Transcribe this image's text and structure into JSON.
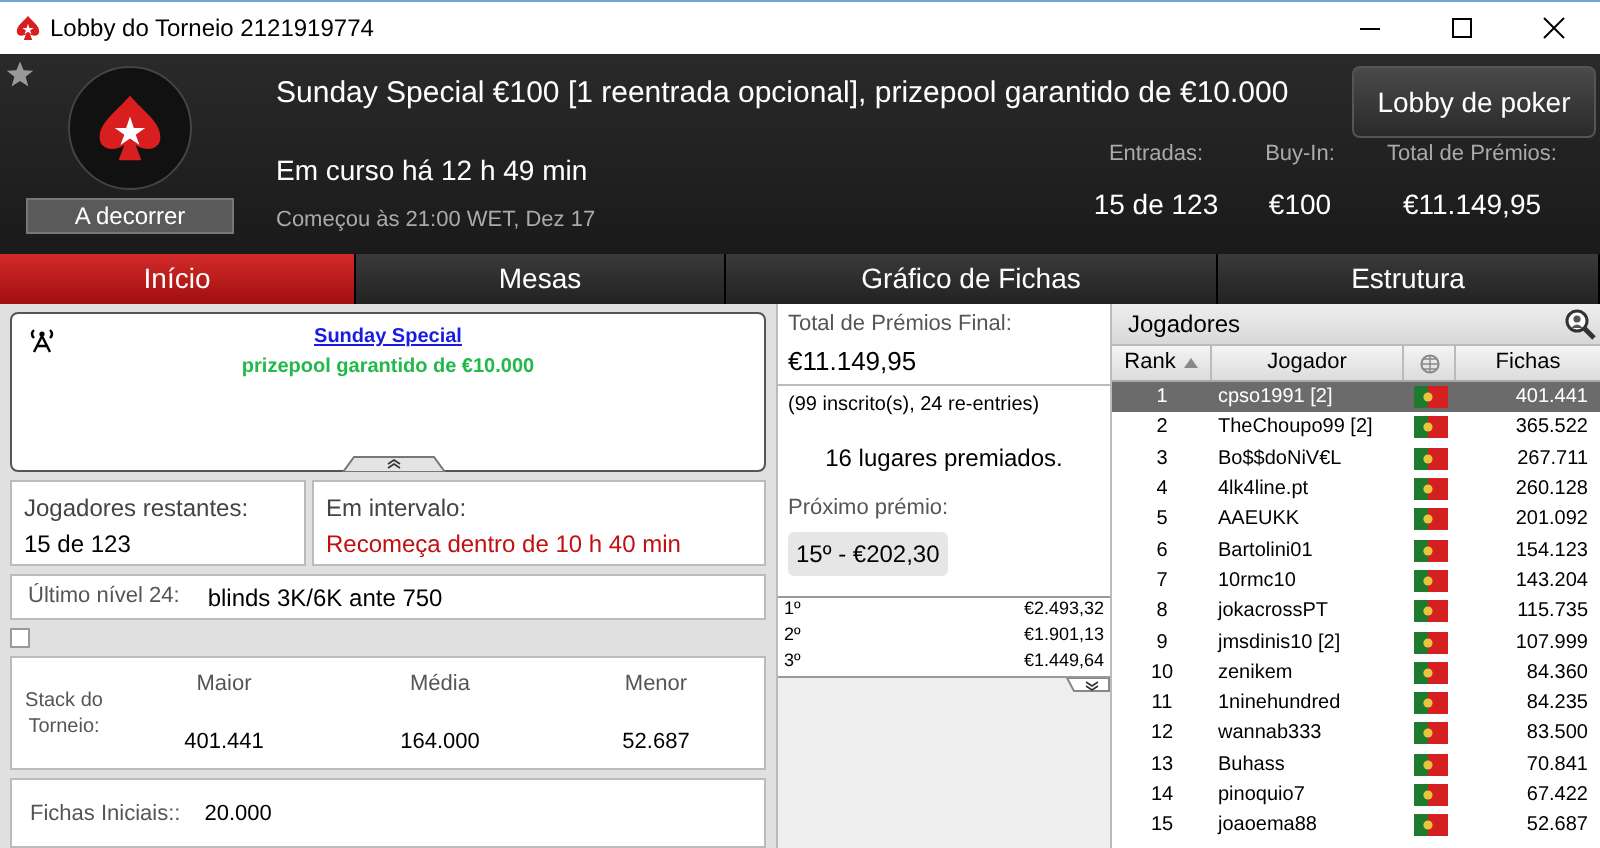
{
  "window": {
    "title": "Lobby do Torneio 2121919774"
  },
  "header": {
    "title": "Sunday Special €100 [1 reentrada opcional], prizepool garantido de €10.000",
    "status": "A decorrer",
    "running": "Em curso há 12 h 49 min",
    "started": "Começou às 21:00 WET, Dez 17",
    "lobby_button": "Lobby de poker",
    "stats": [
      {
        "label": "Entradas:",
        "value": "15 de 123"
      },
      {
        "label": "Buy-In:",
        "value": "€100"
      },
      {
        "label": "Total de Prémios:",
        "value": "€11.149,95"
      }
    ]
  },
  "tabs": [
    {
      "label": "Início",
      "selected": true
    },
    {
      "label": "Mesas",
      "selected": false
    },
    {
      "label": "Gráfico de Fichas",
      "selected": false
    },
    {
      "label": "Estrutura",
      "selected": false
    }
  ],
  "news": {
    "link": "Sunday Special",
    "subtitle": "prizepool garantido de €10.000"
  },
  "remaining": {
    "label": "Jogadores restantes:",
    "value": "15 de 123"
  },
  "break": {
    "label": "Em intervalo:",
    "value": "Recomeça dentro de 10 h 40 min"
  },
  "last_level": {
    "label": "Último nível 24:",
    "value": "blinds 3K/6K ante 750"
  },
  "checkbox": {
    "checked": false
  },
  "stack": {
    "label": "Stack do Torneio:",
    "columns": [
      {
        "label": "Maior",
        "value": "401.441"
      },
      {
        "label": "Média",
        "value": "164.000"
      },
      {
        "label": "Menor",
        "value": "52.687"
      }
    ]
  },
  "starting_chips": {
    "label": "Fichas Iniciais::",
    "value": "20.000"
  },
  "prizes": {
    "total_label": "Total de Prémios Final:",
    "total": "€11.149,95",
    "entries": "(99 inscrito(s), 24 re-entries)",
    "paid": "16 lugares premiados.",
    "next_label": "Próximo prémio:",
    "next": "15º - €202,30",
    "rows": [
      {
        "place": "1º",
        "amount": "€2.493,32"
      },
      {
        "place": "2º",
        "amount": "€1.901,13"
      },
      {
        "place": "3º",
        "amount": "€1.449,64"
      }
    ]
  },
  "players": {
    "title": "Jogadores",
    "columns": [
      "Rank",
      "Jogador",
      "Fichas"
    ],
    "rows": [
      {
        "rank": "1",
        "name": "cpso1991 [2]",
        "chips": "401.441",
        "selected": true
      },
      {
        "rank": "2",
        "name": "TheChoupo99 [2]",
        "chips": "365.522",
        "selected": false
      },
      {
        "rank": "3",
        "name": "Bo$$doNiV€L",
        "chips": "267.711",
        "selected": false
      },
      {
        "rank": "4",
        "name": "4lk4line.pt",
        "chips": "260.128",
        "selected": false
      },
      {
        "rank": "5",
        "name": "AAEUKK",
        "chips": "201.092",
        "selected": false
      },
      {
        "rank": "6",
        "name": "Bartolini01",
        "chips": "154.123",
        "selected": false
      },
      {
        "rank": "7",
        "name": "10rmc10",
        "chips": "143.204",
        "selected": false
      },
      {
        "rank": "8",
        "name": "jokacrossPT",
        "chips": "115.735",
        "selected": false
      },
      {
        "rank": "9",
        "name": "jmsdinis10 [2]",
        "chips": "107.999",
        "selected": false
      },
      {
        "rank": "10",
        "name": "zenikem",
        "chips": "84.360",
        "selected": false
      },
      {
        "rank": "11",
        "name": "1ninehundred",
        "chips": "84.235",
        "selected": false
      },
      {
        "rank": "12",
        "name": "wannab333",
        "chips": "83.500",
        "selected": false
      },
      {
        "rank": "13",
        "name": "Buhass",
        "chips": "70.841",
        "selected": false
      },
      {
        "rank": "14",
        "name": "pinoquio7",
        "chips": "67.422",
        "selected": false
      },
      {
        "rank": "15",
        "name": "joaoema88",
        "chips": "52.687",
        "selected": false
      }
    ]
  }
}
